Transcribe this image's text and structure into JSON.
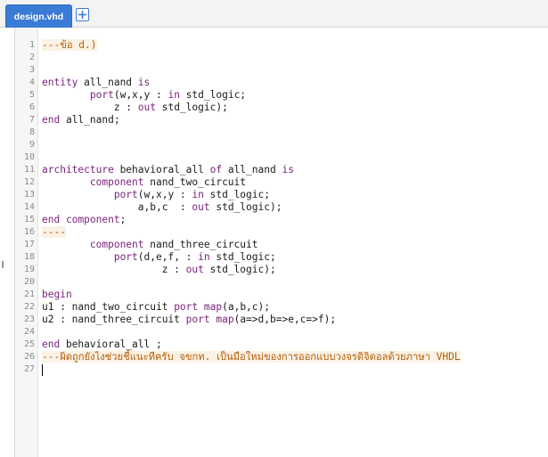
{
  "tabs": {
    "active_label": "design.vhd"
  },
  "editor": {
    "lines": [
      {
        "n": "1",
        "segs": [
          {
            "t": "---ข้อ d.)",
            "c": "cm"
          }
        ]
      },
      {
        "n": "2",
        "segs": []
      },
      {
        "n": "3",
        "segs": []
      },
      {
        "n": "4",
        "segs": [
          {
            "t": "entity",
            "c": "kw"
          },
          {
            "t": " all_nand ",
            "c": ""
          },
          {
            "t": "is",
            "c": "kw"
          }
        ]
      },
      {
        "n": "5",
        "segs": [
          {
            "t": "        ",
            "c": ""
          },
          {
            "t": "port",
            "c": "kw"
          },
          {
            "t": "(w,x,y : ",
            "c": ""
          },
          {
            "t": "in",
            "c": "kw"
          },
          {
            "t": " std_logic;",
            "c": ""
          }
        ]
      },
      {
        "n": "6",
        "segs": [
          {
            "t": "            z : ",
            "c": ""
          },
          {
            "t": "out",
            "c": "kw"
          },
          {
            "t": " std_logic);",
            "c": ""
          }
        ]
      },
      {
        "n": "7",
        "segs": [
          {
            "t": "end",
            "c": "kw"
          },
          {
            "t": " all_nand;",
            "c": ""
          }
        ]
      },
      {
        "n": "8",
        "segs": []
      },
      {
        "n": "9",
        "segs": []
      },
      {
        "n": "10",
        "segs": []
      },
      {
        "n": "11",
        "segs": [
          {
            "t": "architecture",
            "c": "kw"
          },
          {
            "t": " behavioral_all ",
            "c": ""
          },
          {
            "t": "of",
            "c": "kw"
          },
          {
            "t": " all_nand ",
            "c": ""
          },
          {
            "t": "is",
            "c": "kw"
          }
        ]
      },
      {
        "n": "12",
        "segs": [
          {
            "t": "        ",
            "c": ""
          },
          {
            "t": "component",
            "c": "kw"
          },
          {
            "t": " nand_two_circuit",
            "c": ""
          }
        ]
      },
      {
        "n": "13",
        "segs": [
          {
            "t": "            ",
            "c": ""
          },
          {
            "t": "port",
            "c": "kw"
          },
          {
            "t": "(w,x,y : ",
            "c": ""
          },
          {
            "t": "in",
            "c": "kw"
          },
          {
            "t": " std_logic;",
            "c": ""
          }
        ]
      },
      {
        "n": "14",
        "segs": [
          {
            "t": "                a,b,c  : ",
            "c": ""
          },
          {
            "t": "out",
            "c": "kw"
          },
          {
            "t": " std_logic);",
            "c": ""
          }
        ]
      },
      {
        "n": "15",
        "segs": [
          {
            "t": "end",
            "c": "kw"
          },
          {
            "t": " ",
            "c": ""
          },
          {
            "t": "component",
            "c": "kw"
          },
          {
            "t": ";",
            "c": ""
          }
        ]
      },
      {
        "n": "16",
        "segs": [
          {
            "t": "----",
            "c": "cm"
          }
        ]
      },
      {
        "n": "17",
        "segs": [
          {
            "t": "        ",
            "c": ""
          },
          {
            "t": "component",
            "c": "kw"
          },
          {
            "t": " nand_three_circuit",
            "c": ""
          }
        ]
      },
      {
        "n": "18",
        "segs": [
          {
            "t": "            ",
            "c": ""
          },
          {
            "t": "port",
            "c": "kw"
          },
          {
            "t": "(d,e,f, : ",
            "c": ""
          },
          {
            "t": "in",
            "c": "kw"
          },
          {
            "t": " std_logic;",
            "c": ""
          }
        ]
      },
      {
        "n": "19",
        "segs": [
          {
            "t": "                    z : ",
            "c": ""
          },
          {
            "t": "out",
            "c": "kw"
          },
          {
            "t": " std_logic);",
            "c": ""
          }
        ]
      },
      {
        "n": "20",
        "segs": []
      },
      {
        "n": "21",
        "segs": [
          {
            "t": "begin",
            "c": "kw"
          }
        ]
      },
      {
        "n": "22",
        "segs": [
          {
            "t": "u1 : nand_two_circuit ",
            "c": ""
          },
          {
            "t": "port",
            "c": "kw"
          },
          {
            "t": " ",
            "c": ""
          },
          {
            "t": "map",
            "c": "kw"
          },
          {
            "t": "(a,b,c);",
            "c": ""
          }
        ]
      },
      {
        "n": "23",
        "segs": [
          {
            "t": "u2 : nand_three_circuit ",
            "c": ""
          },
          {
            "t": "port",
            "c": "kw"
          },
          {
            "t": " ",
            "c": ""
          },
          {
            "t": "map",
            "c": "kw"
          },
          {
            "t": "(a=>d,b=>e,c=>f);",
            "c": ""
          }
        ]
      },
      {
        "n": "24",
        "segs": []
      },
      {
        "n": "25",
        "segs": [
          {
            "t": "end",
            "c": "kw"
          },
          {
            "t": " behavioral_all ;",
            "c": ""
          }
        ]
      },
      {
        "n": "26",
        "segs": [
          {
            "t": "---ผิดถูกยังไงช่วยชี้แนะทีครับ จขกท. เป็นมือใหม่ของการออกแบบวงจรดิจิตอลด้วยภาษา VHDL",
            "c": "cm"
          }
        ]
      },
      {
        "n": "27",
        "segs": []
      }
    ]
  }
}
